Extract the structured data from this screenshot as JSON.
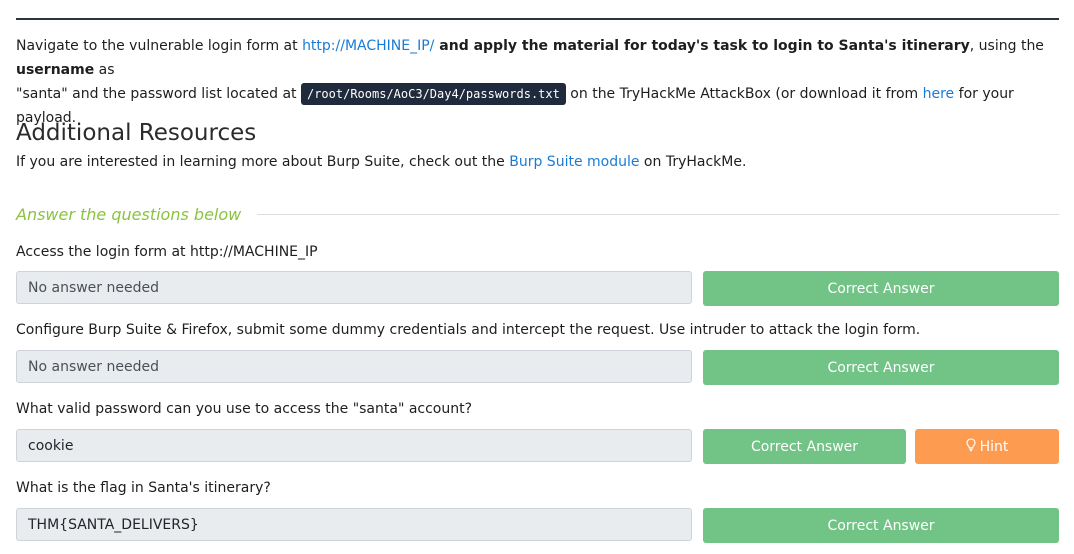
{
  "intro": {
    "t1": "Navigate to the vulnerable login form at ",
    "link1": "http://MACHINE_IP/",
    "t2": " and apply the material for today's task to login to Santa's itinerary",
    "t3": ", using the ",
    "bold_username": "username",
    "t4": " as",
    "t5": "\"santa\" and the password list located at ",
    "path": "/root/Rooms/AoC3/Day4/passwords.txt",
    "t6": " on the TryHackMe AttackBox (or download it from ",
    "link2": "here",
    "t7": " for your payload."
  },
  "resources": {
    "title": "Additional Resources",
    "t1": "If you are interested in learning more about Burp Suite, check out the ",
    "link": "Burp Suite module",
    "t2": " on TryHackMe."
  },
  "questions_header": "Answer the questions below",
  "questions": [
    {
      "text": "Access the login form at http://MACHINE_IP",
      "answer": "No answer needed",
      "button": "Correct Answer"
    },
    {
      "text": "Configure Burp Suite & Firefox, submit some dummy credentials and intercept the request. Use intruder to attack the login form.",
      "answer": "No answer needed",
      "button": "Correct Answer"
    },
    {
      "text": "What valid password can you use to access the \"santa\" account?",
      "answer": "cookie",
      "button": "Correct Answer",
      "hint": "Hint"
    },
    {
      "text": "What is the flag in Santa's itinerary?",
      "answer": "THM{SANTA_DELIVERS}",
      "button": "Correct Answer"
    }
  ],
  "colors": {
    "link": "#1a7bd6",
    "correct": "#72c486",
    "hint": "#fd9c50",
    "header_green": "#8ac33f"
  },
  "icons": {
    "hint": "lightbulb-icon"
  }
}
